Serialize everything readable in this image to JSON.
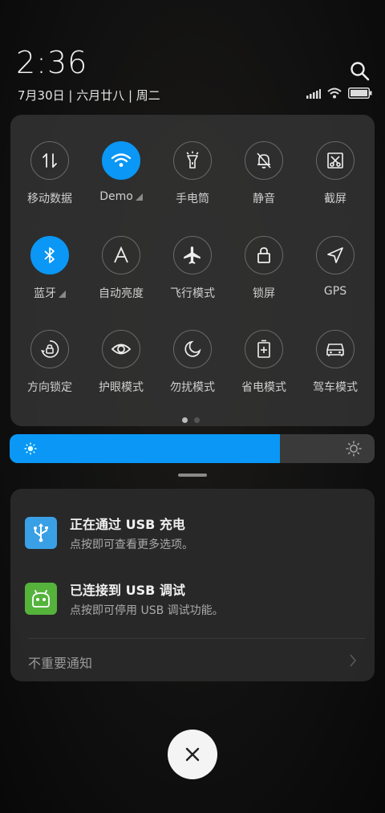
{
  "header": {
    "time": "2:36",
    "date": "7月30日 | 六月廿八 | 周二"
  },
  "toggles": [
    {
      "label": "移动数据",
      "icon": "mobile-data-icon",
      "on": false
    },
    {
      "label": "Demo",
      "icon": "wifi-icon",
      "on": true,
      "expand": true
    },
    {
      "label": "手电筒",
      "icon": "flashlight-icon",
      "on": false
    },
    {
      "label": "静音",
      "icon": "mute-bell-icon",
      "on": false
    },
    {
      "label": "截屏",
      "icon": "screenshot-icon",
      "on": false
    },
    {
      "label": "蓝牙",
      "icon": "bluetooth-icon",
      "on": true,
      "expand": true
    },
    {
      "label": "自动亮度",
      "icon": "auto-brightness-icon",
      "on": false
    },
    {
      "label": "飞行模式",
      "icon": "airplane-icon",
      "on": false
    },
    {
      "label": "锁屏",
      "icon": "lock-icon",
      "on": false
    },
    {
      "label": "GPS",
      "icon": "gps-icon",
      "on": false
    },
    {
      "label": "方向锁定",
      "icon": "rotation-lock-icon",
      "on": false
    },
    {
      "label": "护眼模式",
      "icon": "eye-icon",
      "on": false
    },
    {
      "label": "勿扰模式",
      "icon": "moon-icon",
      "on": false
    },
    {
      "label": "省电模式",
      "icon": "battery-saver-icon",
      "on": false
    },
    {
      "label": "驾车模式",
      "icon": "car-icon",
      "on": false
    }
  ],
  "pager": {
    "pages": 2,
    "current": 1
  },
  "brightness": {
    "level": 0.74,
    "accent": "#0a97f5"
  },
  "notifications": [
    {
      "title": "正在通过 USB 充电",
      "body": "点按即可查看更多选项。",
      "icon": "usb-icon",
      "color": "#3aa0e6"
    },
    {
      "title": "已连接到 USB 调试",
      "body": "点按即可停用 USB 调试功能。",
      "icon": "android-icon",
      "color": "#55b33c"
    }
  ],
  "unimportant_label": "不重要通知"
}
